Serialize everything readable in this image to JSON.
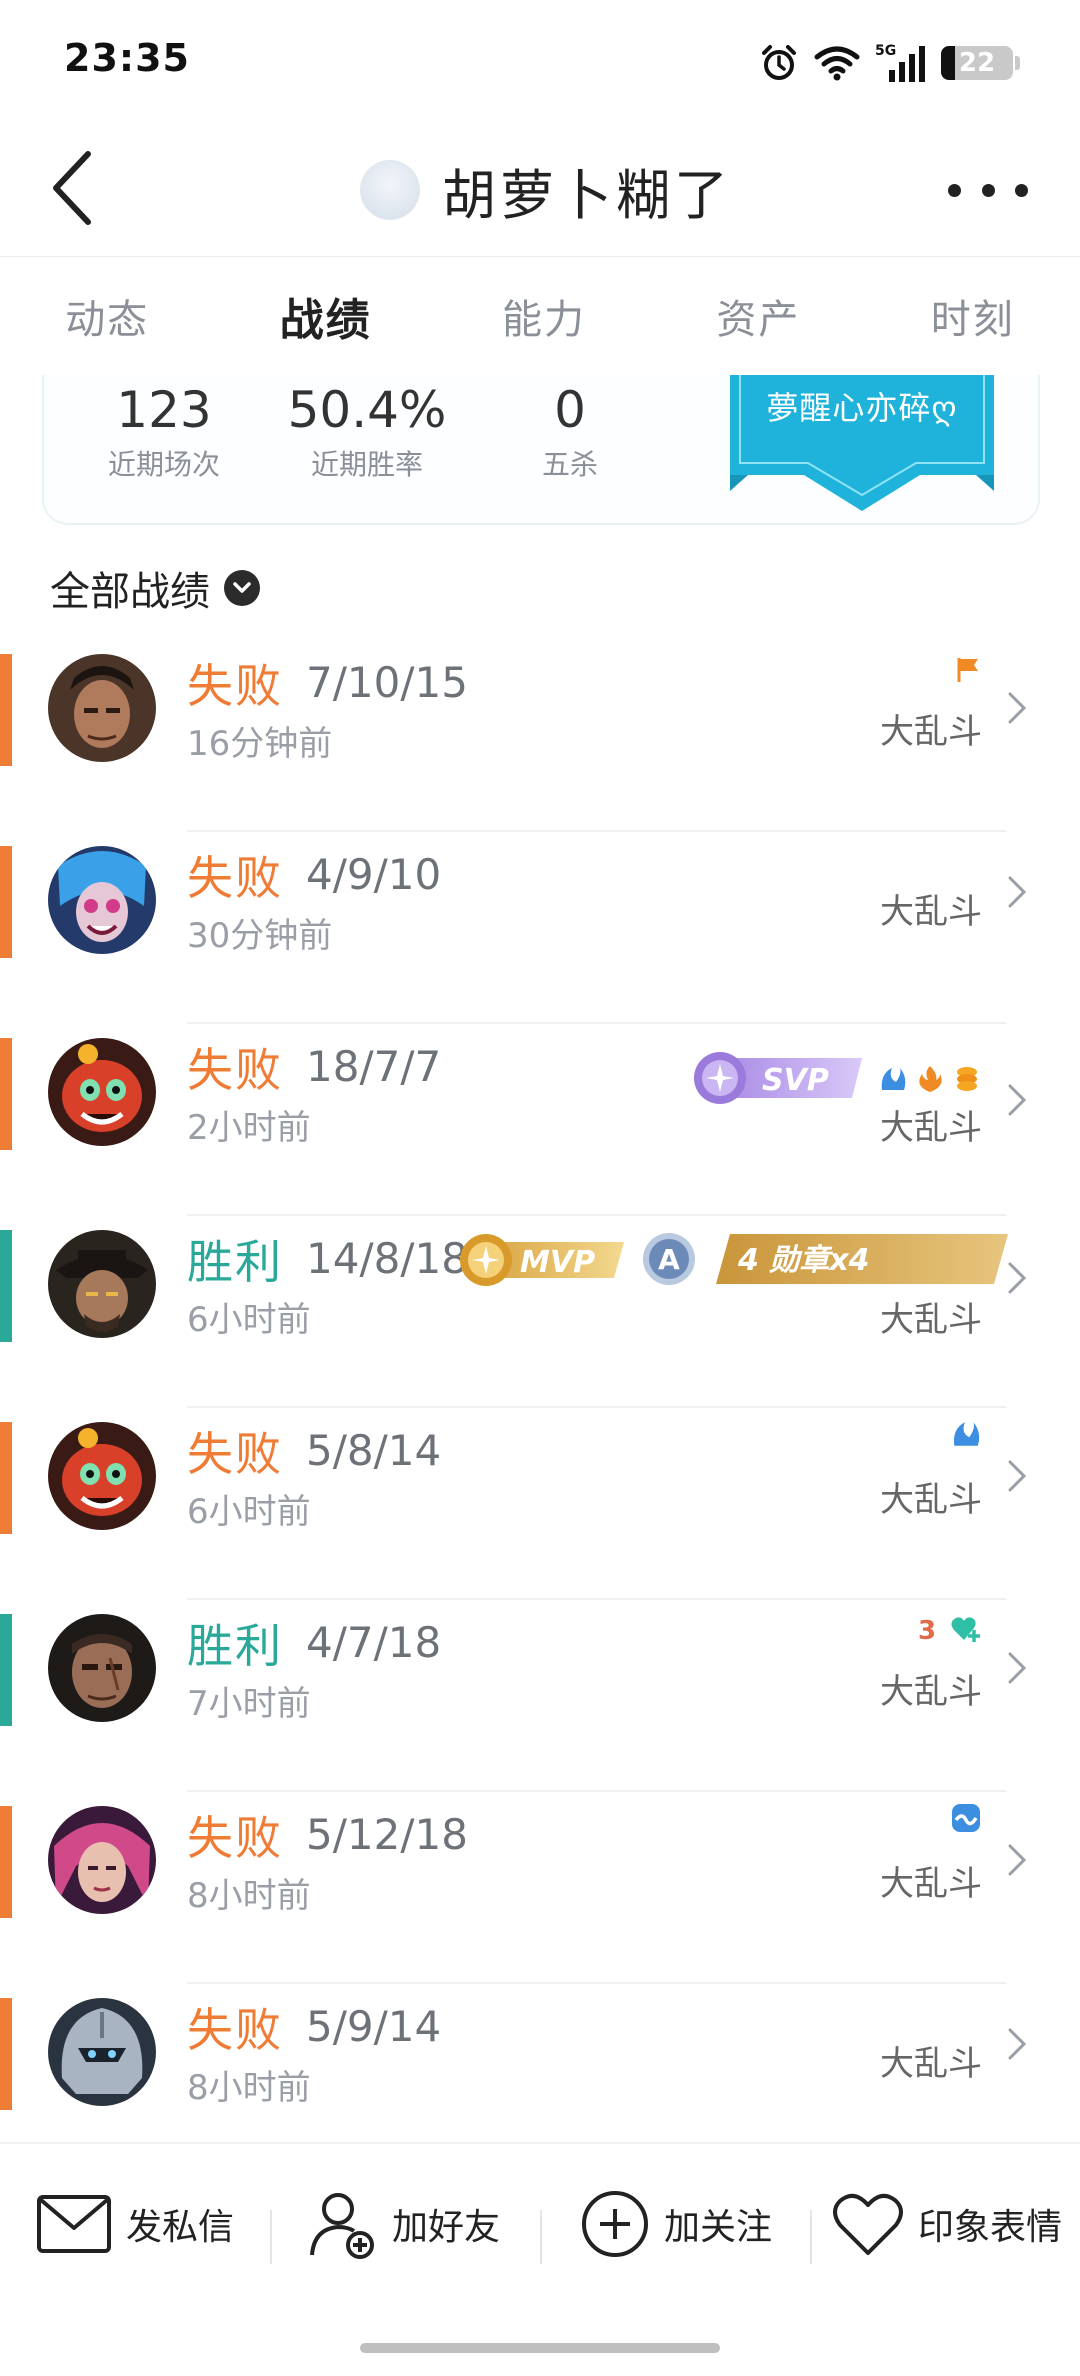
{
  "status_bar": {
    "time": "23:35",
    "battery": "22",
    "network": "5G"
  },
  "nav": {
    "title": "胡萝卜糊了"
  },
  "tabs": [
    {
      "label": "动态",
      "active": false
    },
    {
      "label": "战绩",
      "active": true
    },
    {
      "label": "能力",
      "active": false
    },
    {
      "label": "资产",
      "active": false
    },
    {
      "label": "时刻",
      "active": false
    }
  ],
  "summary": {
    "stats": [
      {
        "value": "123",
        "label": "近期场次"
      },
      {
        "value": "50.4%",
        "label": "近期胜率"
      },
      {
        "value": "0",
        "label": "五杀"
      }
    ],
    "banner_text": "夢醒心亦碎ღ"
  },
  "filter": {
    "label": "全部战绩"
  },
  "colors": {
    "loss": "#ef7c35",
    "win": "#2aa99a",
    "accent_blue": "#1fb3dc"
  },
  "matches": [
    {
      "result": "失败",
      "kda": "7/10/15",
      "time": "16分钟前",
      "mode": "大乱斗"
    },
    {
      "result": "失败",
      "kda": "4/9/10",
      "time": "30分钟前",
      "mode": "大乱斗"
    },
    {
      "result": "失败",
      "kda": "18/7/7",
      "time": "2小时前",
      "mode": "大乱斗"
    },
    {
      "result": "胜利",
      "kda": "14/8/18",
      "time": "6小时前",
      "mode": "大乱斗"
    },
    {
      "result": "失败",
      "kda": "5/8/14",
      "time": "6小时前",
      "mode": "大乱斗"
    },
    {
      "result": "胜利",
      "kda": "4/7/18",
      "time": "7小时前",
      "mode": "大乱斗"
    },
    {
      "result": "失败",
      "kda": "5/12/18",
      "time": "8小时前",
      "mode": "大乱斗"
    },
    {
      "result": "失败",
      "kda": "5/9/14",
      "time": "8小时前",
      "mode": "大乱斗"
    }
  ],
  "badges": {
    "svp": "SVP",
    "mvp": "MVP",
    "grade": "A",
    "medal": "4 勋章x4",
    "streak": "3"
  },
  "actions": [
    {
      "label": "发私信"
    },
    {
      "label": "加好友"
    },
    {
      "label": "加关注"
    },
    {
      "label": "印象表情"
    }
  ]
}
